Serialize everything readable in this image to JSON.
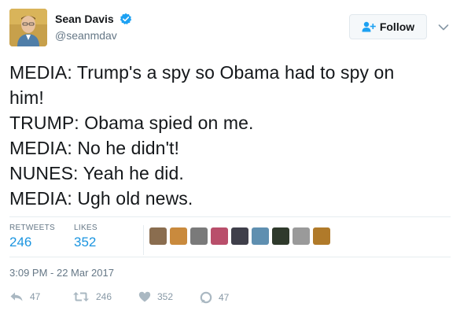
{
  "user": {
    "display_name": "Sean Davis",
    "handle": "@seanmdav"
  },
  "follow_label": "Follow",
  "tweet_lines": [
    "MEDIA: Trump's a spy so Obama had to spy on",
    "him!",
    "TRUMP: Obama spied on me.",
    "MEDIA: No he didn't!",
    "NUNES: Yeah he did.",
    "MEDIA: Ugh old news."
  ],
  "stats": {
    "retweets_label": "RETWEETS",
    "retweets_value": "246",
    "likes_label": "LIKES",
    "likes_value": "352"
  },
  "liker_avatar_colors": [
    "#8a6d4f",
    "#c98a3d",
    "#7a7a7a",
    "#b94f6b",
    "#3f3f4a",
    "#5f8fb0",
    "#2f3a2c",
    "#9a9a9a",
    "#b07a2a"
  ],
  "timestamp": "3:09 PM - 22 Mar 2017",
  "actions": {
    "reply_count": "47",
    "retweet_count": "246",
    "like_count": "352",
    "dm_count": "47"
  },
  "colors": {
    "link_blue": "#1b95e0",
    "verified_blue": "#1da1f2",
    "muted_gray": "#657786",
    "action_gray": "#aab8c2"
  }
}
